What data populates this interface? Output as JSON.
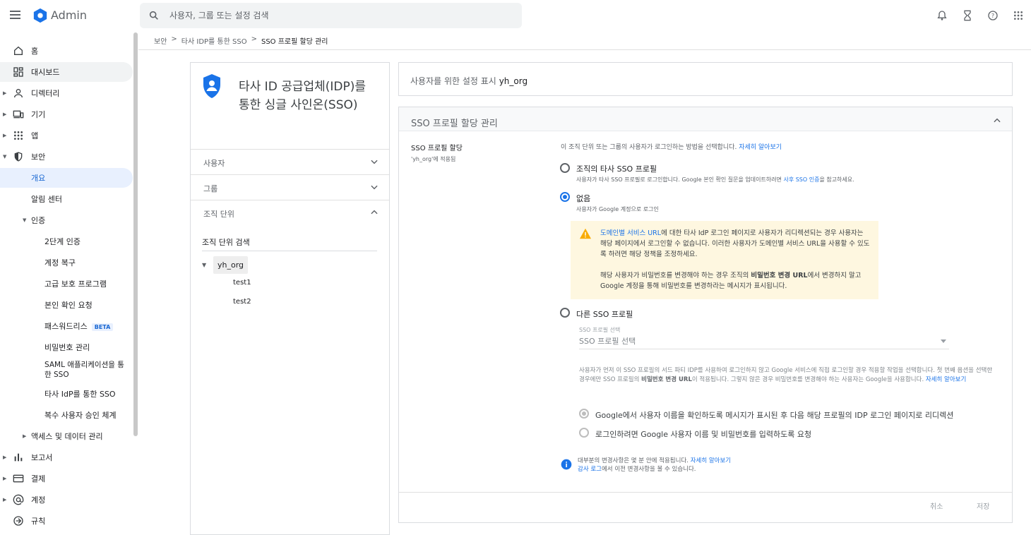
{
  "app": {
    "title": "Admin"
  },
  "search": {
    "placeholder": "사용자, 그룹 또는 설정 검색"
  },
  "topbar_icons": [
    "bell-icon",
    "hourglass-icon",
    "help-icon",
    "apps-grid-icon"
  ],
  "sidebar": {
    "items": [
      {
        "label": "홈",
        "icon": "home-icon"
      },
      {
        "label": "대시보드",
        "icon": "dashboard-icon"
      },
      {
        "label": "디렉터리",
        "icon": "person-icon"
      },
      {
        "label": "기기",
        "icon": "devices-icon"
      },
      {
        "label": "앱",
        "icon": "apps-icon"
      },
      {
        "label": "보안",
        "icon": "shield-icon"
      },
      {
        "label": "개요"
      },
      {
        "label": "알림 센터"
      },
      {
        "label": "인증"
      },
      {
        "label": "2단계 인증"
      },
      {
        "label": "계정 복구"
      },
      {
        "label": "고급 보호 프로그램"
      },
      {
        "label": "본인 확인 요청"
      },
      {
        "label": "패스워드리스",
        "badge": "BETA"
      },
      {
        "label": "비밀번호 관리"
      },
      {
        "label": "SAML 애플리케이션을 통한 SSO"
      },
      {
        "label": "타사 IdP를 통한 SSO"
      },
      {
        "label": "복수 사용자 승인 체계"
      },
      {
        "label": "액세스 및 데이터 관리"
      },
      {
        "label": "보고서",
        "icon": "bar-chart-icon"
      },
      {
        "label": "결제",
        "icon": "credit-card-icon"
      },
      {
        "label": "계정",
        "icon": "at-icon"
      },
      {
        "label": "규칙",
        "icon": "rules-icon"
      }
    ]
  },
  "breadcrumb": [
    "보안",
    "타사 IDP를 통한 SSO",
    "SSO 프로필 할당 관리"
  ],
  "left_card": {
    "title": "타사 ID 공급업체(IDP)를 통한 싱글 사인온(SSO)",
    "sections": [
      "사용자",
      "그룹",
      "조직 단위"
    ],
    "ou_search_value": "조직 단위 검색",
    "tree": {
      "root": "yh_org",
      "children": [
        "test1",
        "test2"
      ]
    }
  },
  "panel_top": {
    "label": "사용자를 위한 설정 표시",
    "org": "yh_org"
  },
  "panel": {
    "heading": "SSO 프로필 할당 관리",
    "setting_label": "SSO 프로필 할당",
    "setting_sub": "'yh_org'에 적용됨",
    "desc": "이 조직 단위 또는 그룹의 사용자가 로그인하는 방법을 선택합니다.",
    "desc_link": "자세히 알아보기",
    "options": [
      {
        "label": "조직의 타사 SSO 프로필",
        "sub": "사용자가 타사 SSO 프로필로 로그인합니다. Google 본인 확인 질문을 업데이트하려면",
        "sub_link": "사후 SSO 인증",
        "sub_end": "을 참고하세요."
      },
      {
        "label": "없음",
        "sub": "사용자가 Google 계정으로 로그인"
      },
      {
        "label": "다른 SSO 프로필"
      }
    ],
    "warning": {
      "link": "도메인별 서비스 URL",
      "text1": "에 대한 타사 IdP 로그인 페이지로 사용자가 리디렉션되는 경우 사용자는 해당 페이지에서 로그인할 수 없습니다. 이러한 사용자가 도메인별 서비스 URL을 사용할 수 있도록 하려면 해당 정책을 조정하세요.",
      "text2a": "해당 사용자가 비밀번호를 변경해야 하는 경우 조직의 ",
      "text2b": "비밀번호 변경 URL",
      "text2c": "에서 변경하지 말고 Google 계정을 통해 비밀번호를 변경하라는 메시지가 표시됩니다."
    },
    "sso_select": {
      "label": "SSO 프로필 선택",
      "value": "SSO 프로필 선택"
    },
    "para": {
      "a": "사용자가 먼저 이 SSO 프로필의 서드 파티 IDP를 사용하여 로그인하지 않고 Google 서비스에 직접 로그인할 경우 적용할 작업을 선택합니다. 첫 번째 옵션을 선택한 경우에만 SSO 프로필의 ",
      "b": "비밀번호 변경 URL",
      "c": "이 적용됩니다. 그렇지 않은 경우 비밀번호를 변경해야 하는 사용자는 Google을 사용합니다. ",
      "link": "자세히 알아보기"
    },
    "sub_options": [
      "Google에서 사용자 이름을 확인하도록 메시지가 표시된 후 다음 해당 프로필의 IDP 로그인 페이지로 리디렉션",
      "로그인하려면 Google 사용자 이름 및 비밀번호를 입력하도록 요청"
    ],
    "info": {
      "line1": "대부분의 변경사항은 몇 분 안에 적용됩니다.",
      "line1_link": "자세히 알아보기",
      "line2_link": "감사 로그",
      "line2": "에서 이전 변경사항을 볼 수 있습니다."
    },
    "buttons": {
      "cancel": "취소",
      "save": "저장"
    }
  },
  "colors": {
    "accent": "#1a73e8",
    "warning_bg": "#fef7e0",
    "warning_icon": "#f9ab00",
    "shield": "#1a73e8"
  }
}
